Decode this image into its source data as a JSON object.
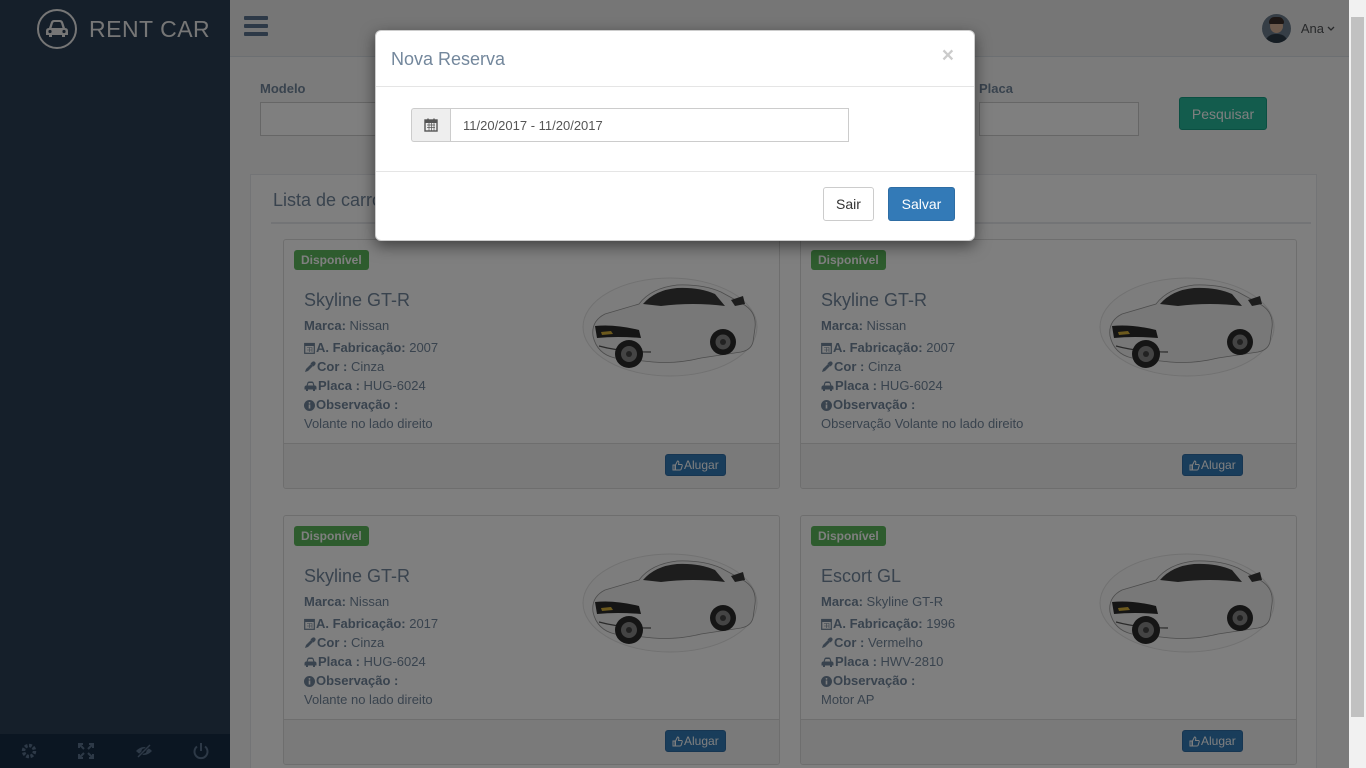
{
  "app": {
    "brand": "RENT CAR"
  },
  "topnav": {
    "user_name": "Ana"
  },
  "search": {
    "model_label": "Modelo",
    "plate_label": "Placa",
    "search_button": "Pesquisar"
  },
  "list": {
    "title": "Lista de carro",
    "cards": [
      {
        "badge": "Disponível",
        "model": "Skyline GT-R",
        "brand_label": "Marca:",
        "brand": "Nissan",
        "year_label": "A. Fabricação:",
        "year": "2007",
        "color_label": "Cor :",
        "color": "Cinza",
        "plate_label": "Placa :",
        "plate": "HUG-6024",
        "obs_label": "Observação :",
        "obs": "Volante no lado direito",
        "button": "Alugar"
      },
      {
        "badge": "Disponível",
        "model": "Skyline GT-R",
        "brand_label": "Marca:",
        "brand": "Nissan",
        "year_label": "A. Fabricação:",
        "year": "2007",
        "color_label": "Cor :",
        "color": "Cinza",
        "plate_label": "Placa :",
        "plate": "HUG-6024",
        "obs_label": "Observação :",
        "obs": "Observação Volante no lado direito",
        "button": "Alugar"
      },
      {
        "badge": "Disponível",
        "model": "Skyline GT-R",
        "brand_label": "Marca:",
        "brand": "Nissan",
        "year_label": "A. Fabricação:",
        "year": "2017",
        "color_label": "Cor :",
        "color": "Cinza",
        "plate_label": "Placa :",
        "plate": "HUG-6024",
        "obs_label": "Observação :",
        "obs": "Volante no lado direito",
        "button": "Alugar"
      },
      {
        "badge": "Disponível",
        "model": "Escort GL",
        "brand_label": "Marca:",
        "brand": "Skyline GT-R",
        "year_label": "A. Fabricação:",
        "year": "1996",
        "color_label": "Cor :",
        "color": "Vermelho",
        "plate_label": "Placa :",
        "plate": "HWV-2810",
        "obs_label": "Observação :",
        "obs": "Motor AP",
        "button": "Alugar"
      }
    ]
  },
  "modal": {
    "title": "Nova Reserva",
    "close": "×",
    "date_range": "11/20/2017 - 11/20/2017",
    "cancel_button": "Sair",
    "save_button": "Salvar"
  },
  "colors": {
    "sidebar": "#2a3f54",
    "success": "#26b99a",
    "primary": "#337ab7",
    "badge": "#5cb85c"
  },
  "icons": [
    "car-logo-icon",
    "menu-icon",
    "chevron-down-icon",
    "calendar-icon",
    "eyedropper-icon",
    "car-icon",
    "info-icon",
    "thumbs-up-icon",
    "gear-icon",
    "fullscreen-icon",
    "eye-slash-icon",
    "power-icon"
  ]
}
